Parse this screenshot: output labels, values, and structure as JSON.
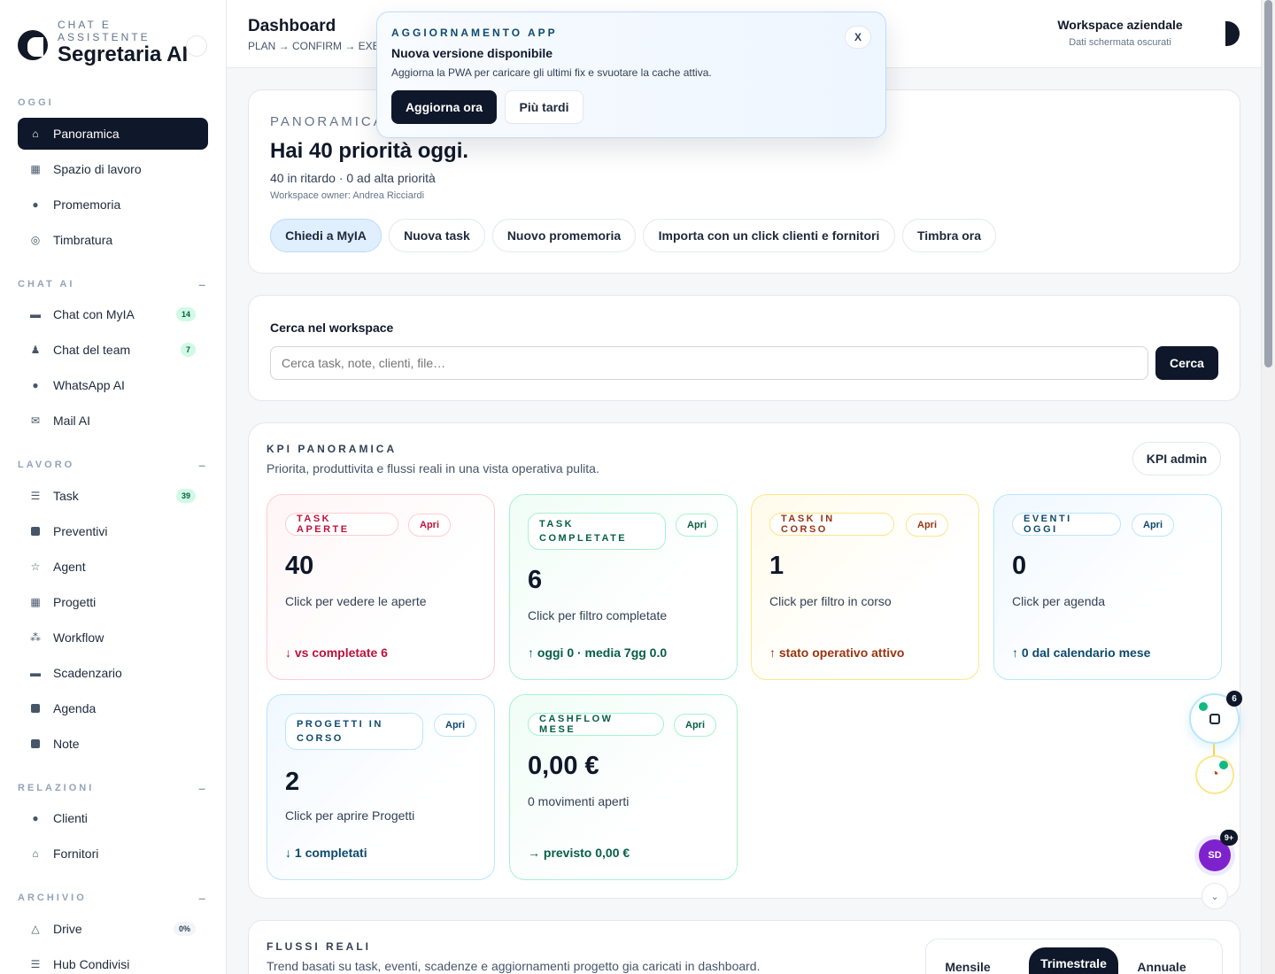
{
  "brand": {
    "subtitle": "CHAT E ASSISTENTE",
    "title": "Segretaria AI"
  },
  "sidebar": {
    "sections": [
      {
        "label": "OGGI"
      },
      {
        "label": "CHAT AI",
        "toggle": "–"
      },
      {
        "label": "LAVORO",
        "toggle": "–"
      },
      {
        "label": "RELAZIONI",
        "toggle": "–"
      },
      {
        "label": "ARCHIVIO",
        "toggle": "–"
      }
    ],
    "items": [
      {
        "label": "Panoramica",
        "icon": "home-icon"
      },
      {
        "label": "Spazio di lavoro",
        "icon": "grid-icon"
      },
      {
        "label": "Promemoria",
        "icon": "bell-icon"
      },
      {
        "label": "Timbratura",
        "icon": "target-icon"
      },
      {
        "label": "Chat con MyIA",
        "icon": "chat-icon",
        "badge": "14"
      },
      {
        "label": "Chat del team",
        "icon": "team-icon",
        "badge": "7"
      },
      {
        "label": "WhatsApp AI",
        "icon": "whatsapp-icon"
      },
      {
        "label": "Mail AI",
        "icon": "mail-icon"
      },
      {
        "label": "Task",
        "icon": "checklist-icon",
        "badge": "39"
      },
      {
        "label": "Preventivi",
        "icon": "document-icon"
      },
      {
        "label": "Agent",
        "icon": "star-icon"
      },
      {
        "label": "Progetti",
        "icon": "grid-icon"
      },
      {
        "label": "Workflow",
        "icon": "workflow-icon"
      },
      {
        "label": "Scadenzario",
        "icon": "card-icon"
      },
      {
        "label": "Agenda",
        "icon": "calendar-icon"
      },
      {
        "label": "Note",
        "icon": "note-icon"
      },
      {
        "label": "Clienti",
        "icon": "user-icon"
      },
      {
        "label": "Fornitori",
        "icon": "home-icon"
      },
      {
        "label": "Drive",
        "icon": "drive-icon",
        "badge": "0%"
      },
      {
        "label": "Hub Condivisi",
        "icon": "hub-icon"
      }
    ]
  },
  "topbar": {
    "title": "Dashboard",
    "breadcrumb": "PLAN → CONFIRM → EXE",
    "workspace_title": "Workspace aziendale",
    "workspace_sub": "Dati schermata oscurati"
  },
  "popup": {
    "eyebrow": "AGGIORNAMENTO APP",
    "title": "Nuova versione disponibile",
    "description": "Aggiorna la PWA per caricare gli ultimi fix e svuotare la cache attiva.",
    "close": "X",
    "primary": "Aggiorna ora",
    "secondary": "Più tardi"
  },
  "hero": {
    "eyebrow": "PANORAMICA",
    "title": "Hai 40 priorità oggi.",
    "stats": "40 in ritardo · 0 ad alta priorità",
    "owner": "Workspace owner: Andrea Ricciardi",
    "actions": [
      "Chiedi a MyIA",
      "Nuova task",
      "Nuovo promemoria",
      "Importa con un click clienti e fornitori",
      "Timbra ora"
    ]
  },
  "search": {
    "label": "Cerca nel workspace",
    "placeholder": "Cerca task, note, clienti, file…",
    "button": "Cerca"
  },
  "kpi": {
    "eyebrow": "KPI PANORAMICA",
    "subtitle": "Priorita, produttivita e flussi reali in una vista operativa pulita.",
    "admin": "KPI admin",
    "cards": [
      {
        "tag": "TASK APERTE",
        "open": "Apri",
        "value": "40",
        "desc": "Click per vedere le aperte",
        "trend": "↓ vs completate 6",
        "color": "#be123c",
        "border": "#fecdd3",
        "bg": "#fff5f7"
      },
      {
        "tag": "TASK COMPLETATE",
        "open": "Apri",
        "value": "6",
        "desc": "Click per filtro completate",
        "trend": "↑ oggi 0 · media 7gg 0.0",
        "color": "#065f46",
        "border": "#a7f3d0",
        "bg": "#f0fdf7"
      },
      {
        "tag": "TASK IN CORSO",
        "open": "Apri",
        "value": "1",
        "desc": "Click per filtro in corso",
        "trend": "↑ stato operativo attivo",
        "color": "#9a3412",
        "border": "#fde68a",
        "bg": "#fffbeb"
      },
      {
        "tag": "EVENTI OGGI",
        "open": "Apri",
        "value": "0",
        "desc": "Click per agenda",
        "trend": "↑ 0 dal calendario mese",
        "color": "#0c4a6e",
        "border": "#bae6fd",
        "bg": "#f0f8ff"
      },
      {
        "tag": "PROGETTI IN CORSO",
        "open": "Apri",
        "value": "2",
        "desc": "Click per aprire Progetti",
        "trend": "↓ 1 completati",
        "color": "#0c4a6e",
        "border": "#bae6fd",
        "bg": "#f0f8ff"
      },
      {
        "tag": "CASHFLOW MESE",
        "open": "Apri",
        "value": "0,00 €",
        "desc": "0 movimenti aperti",
        "trend": "→ previsto 0,00 €",
        "color": "#065f46",
        "border": "#a7f3d0",
        "bg": "#f0fdf7"
      }
    ]
  },
  "flows": {
    "eyebrow": "FLUSSI REALI",
    "subtitle": "Trend basati su task, eventi, scadenze e aggiornamenti progetto gia caricati in dashboard.",
    "periods": [
      "Mensile",
      "Trimestrale",
      "Annuale"
    ],
    "active_period": "Trimestrale"
  },
  "floating": {
    "notes_badge": "6",
    "avatar": "SD",
    "avatar_badge": "9+"
  }
}
